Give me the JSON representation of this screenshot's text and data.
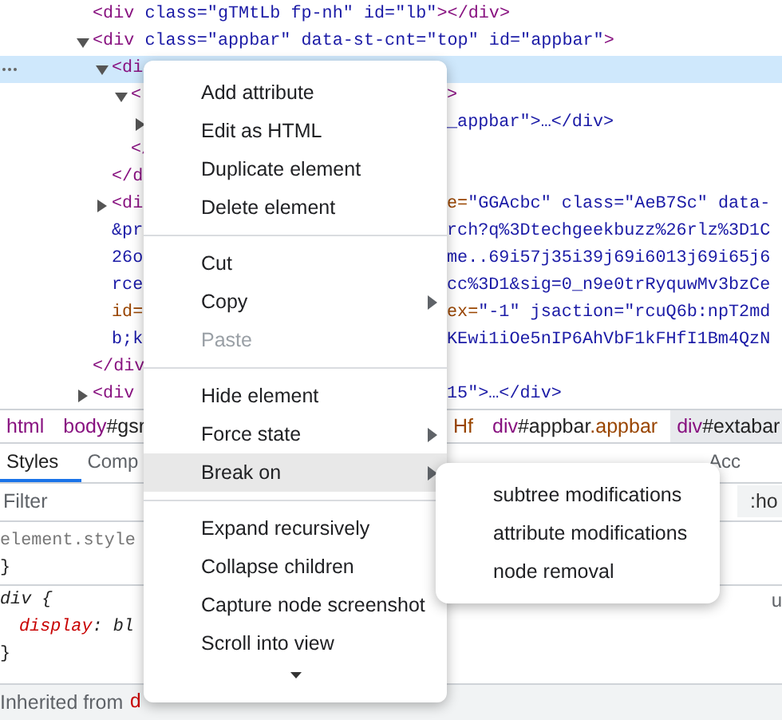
{
  "elements": [
    {
      "left": "<div class=\"gTMtLb fp-nh\" id=\"lb\"></div>"
    },
    {
      "expanded": true,
      "left": "<div class=\"appbar\" data-st-cnt=\"top\" id=\"appbar\">",
      "children": [
        {
          "expanded": true,
          "selected": true,
          "left": "<di",
          "children": [
            {
              "expanded": true,
              "left": "<",
              "right": ">",
              "children": [
                {
                  "expanded": false,
                  "right": "_appbar\">…</div>"
                }
              ],
              "closing": {
                "left": "</"
              }
            }
          ],
          "closing": {
            "left": "</d"
          }
        },
        {
          "expanded": false,
          "left": "<di",
          "right": "e=\"GGAcbc\" class=\"AeB7Sc\" data-",
          "wrapped": [
            {
              "left": "&pr",
              "right": "rch?q%3Dtechgeekbuzz%26rlz%3D1C"
            },
            {
              "left": "26o",
              "right": "me..69i57j35i39j69i6013j69i65j6"
            },
            {
              "left": "rce",
              "right": "cc%3D1&sig=0_n9e0trRyquwMv3bzCe"
            },
            {
              "left": "id=",
              "right": "ex=\"-1\" jsaction=\"rcuQ6b:npT2md"
            },
            {
              "left": "b;k",
              "right": "KEwi1iOe5nIP6AhVbF1kFHfI1Bm4QzN"
            }
          ]
        }
      ],
      "closing": {
        "left": "</div"
      }
    },
    {
      "expanded": false,
      "left": "<div",
      "right": "15\">…</div>"
    }
  ],
  "breadcrumbs": {
    "left": [
      {
        "label": "html",
        "selected": false
      },
      {
        "label": "body#gsr",
        "selected": false
      }
    ],
    "right": [
      {
        "label": "Hf",
        "selected": false
      },
      {
        "label": "div#appbar.appbar",
        "selected": false
      },
      {
        "label": "div#extabar",
        "selected": true
      }
    ]
  },
  "tabs": {
    "left": [
      {
        "label": "Styles",
        "selected": true
      },
      {
        "label": "Comp",
        "selected": false
      }
    ],
    "right": [
      {
        "label": "Acc",
        "selected": false
      }
    ]
  },
  "filter": {
    "placeholder": "Filter",
    "toggle": ":ho"
  },
  "styles": {
    "lines": [
      {
        "kind": "selector",
        "text": "element.style"
      },
      {
        "kind": "brace",
        "text": "}"
      },
      {
        "kind": "rule",
        "text": "div {",
        "source": "u"
      },
      {
        "kind": "declaration",
        "text": "display: bl"
      },
      {
        "kind": "brace",
        "text": "}"
      }
    ],
    "inherited": {
      "label": "Inherited from",
      "element": "d"
    }
  },
  "context_menu": {
    "groups": [
      [
        {
          "label": "Add attribute",
          "kind": "item",
          "disabled": false,
          "highlighted": false
        },
        {
          "label": "Edit as HTML",
          "kind": "item",
          "disabled": false,
          "highlighted": false
        },
        {
          "label": "Duplicate element",
          "kind": "item",
          "disabled": false,
          "highlighted": false
        },
        {
          "label": "Delete element",
          "kind": "item",
          "disabled": false,
          "highlighted": false
        }
      ],
      [
        {
          "label": "Cut",
          "kind": "item",
          "disabled": false,
          "highlighted": false
        },
        {
          "label": "Copy",
          "kind": "submenu",
          "disabled": false,
          "highlighted": false
        },
        {
          "label": "Paste",
          "kind": "item",
          "disabled": true,
          "highlighted": false
        }
      ],
      [
        {
          "label": "Hide element",
          "kind": "item",
          "disabled": false,
          "highlighted": false
        },
        {
          "label": "Force state",
          "kind": "submenu",
          "disabled": false,
          "highlighted": false
        },
        {
          "label": "Break on",
          "kind": "submenu",
          "disabled": false,
          "highlighted": true
        }
      ],
      [
        {
          "label": "Expand recursively",
          "kind": "item",
          "disabled": false,
          "highlighted": false
        },
        {
          "label": "Collapse children",
          "kind": "item",
          "disabled": false,
          "highlighted": false
        },
        {
          "label": "Capture node screenshot",
          "kind": "item",
          "disabled": false,
          "highlighted": false
        },
        {
          "label": "Scroll into view",
          "kind": "item",
          "disabled": false,
          "highlighted": false
        }
      ]
    ],
    "more_below": true
  },
  "submenu": {
    "items": [
      {
        "label": "subtree modifications"
      },
      {
        "label": "attribute modifications"
      },
      {
        "label": "node removal"
      }
    ]
  }
}
